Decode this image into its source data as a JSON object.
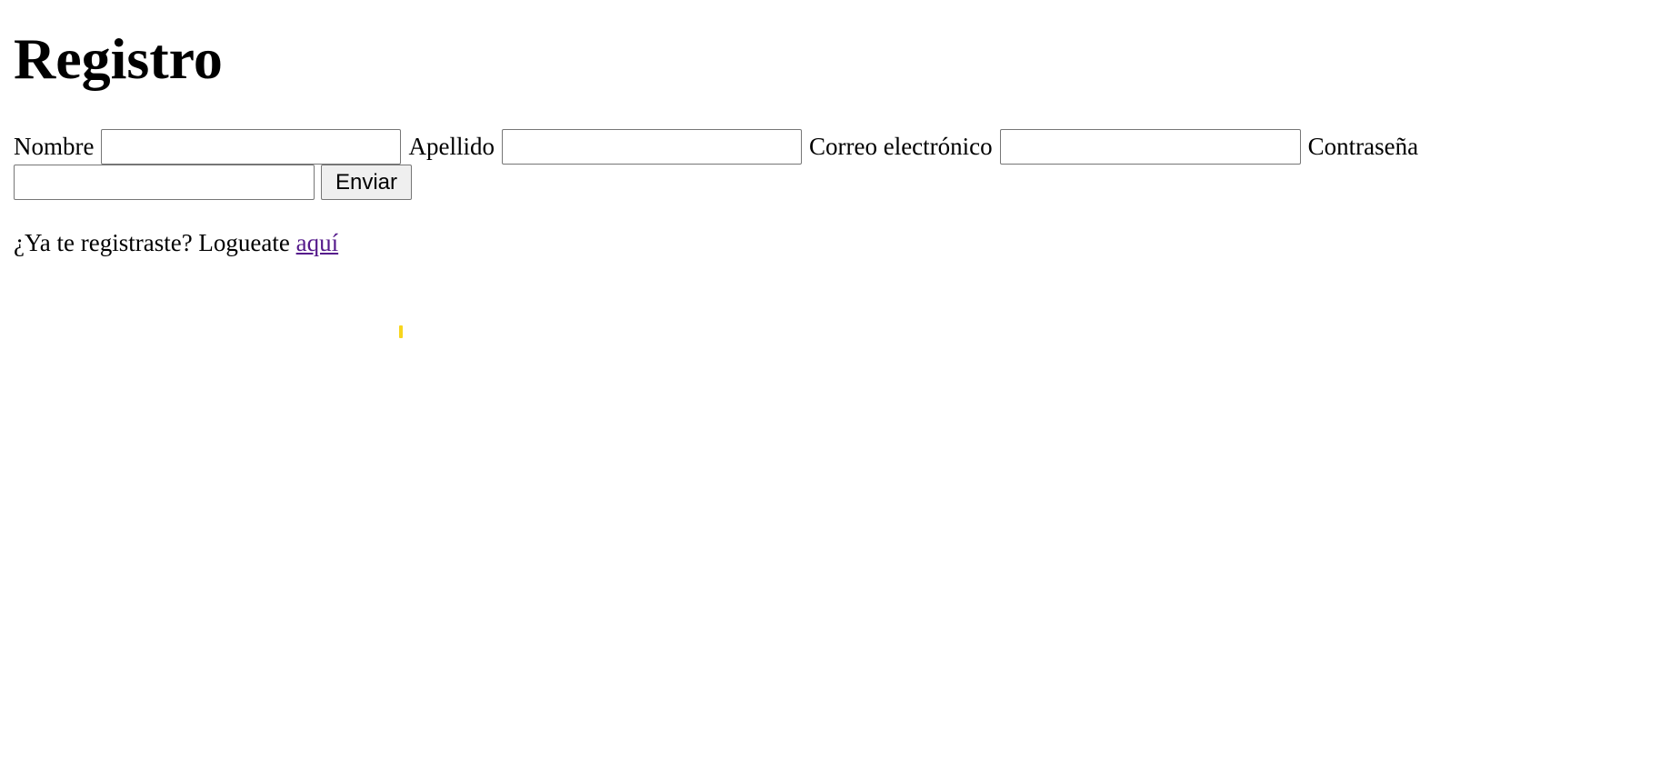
{
  "page": {
    "title": "Registro"
  },
  "form": {
    "nombre_label": "Nombre",
    "nombre_value": "",
    "apellido_label": "Apellido",
    "apellido_value": "",
    "correo_label": "Correo electrónico",
    "correo_value": "",
    "contrasena_label": "Contraseña",
    "contrasena_value": "",
    "submit_label": "Enviar"
  },
  "login": {
    "prompt": "¿Ya te registraste? Logueate",
    "link_text": "aquí"
  },
  "colors": {
    "link_visited": "#551a8b",
    "button_bg": "#efefef",
    "input_border": "#767676",
    "cursor_mark": "#f7d51d"
  }
}
